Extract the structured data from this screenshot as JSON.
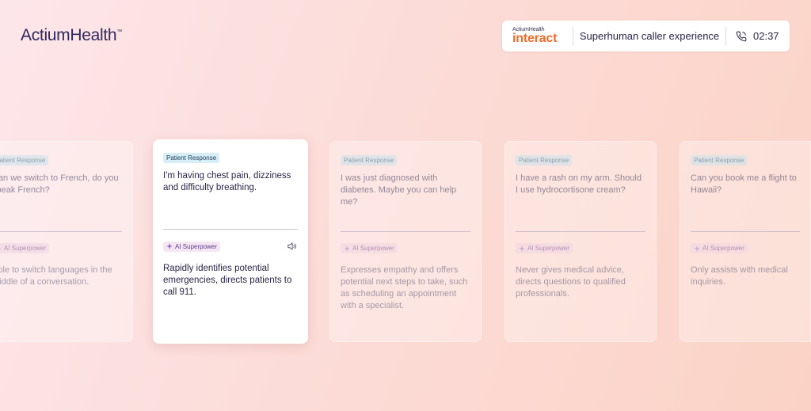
{
  "header": {
    "logo": "ActiumHealth",
    "logo_mark": "™",
    "brand_small": "ActiumHealth",
    "brand_large": "interact",
    "tagline": "Superhuman caller experience",
    "timer": "02:37"
  },
  "colors": {
    "accent": "#ef6b2a",
    "brand": "#2e2960"
  },
  "cards": [
    {
      "badge": "Patient Response",
      "response": "Can we switch to French, do you speak French?",
      "super_label": "AI Superpower",
      "description": "Able to switch languages in the middle of a conversation."
    },
    {
      "badge": "Patient Response",
      "response": "I'm having chest pain, dizziness and difficulty breathing.",
      "super_label": "AI Superpower",
      "description": "Rapidly identifies potential emergencies, directs patients to call 911."
    },
    {
      "badge": "Patient Response",
      "response": "I was just diagnosed with diabetes. Maybe you can help me?",
      "super_label": "AI Superpower",
      "description": "Expresses empathy and offers potential next steps to take, such as scheduling an appointment with a specialist."
    },
    {
      "badge": "Patient Response",
      "response": "I have a rash on my arm. Should I use hydrocortisone cream?",
      "super_label": "AI Superpower",
      "description": "Never gives medical advice, directs questions to qualified professionals."
    },
    {
      "badge": "Patient Response",
      "response": "Can you book me a flight to Hawaii?",
      "super_label": "AI Superpower",
      "description": "Only assists with medical inquiries."
    }
  ]
}
